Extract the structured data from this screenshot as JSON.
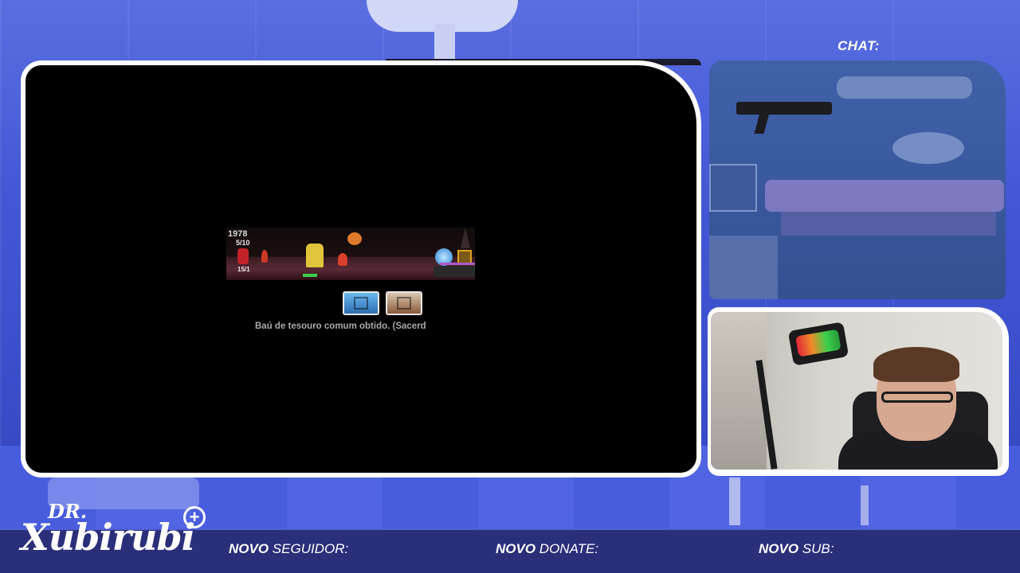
{
  "game": {
    "stat_top": "1978",
    "stat_mid": "5/10",
    "stat_hp": "15/1",
    "message": "Baú de tesouro comum obtido. (Sacerd"
  },
  "chat": {
    "label": "CHAT:"
  },
  "brand": {
    "dr": "DR.",
    "name": "Xubirubi",
    "plus": "+"
  },
  "ticker": {
    "follower_bold": "NOVO",
    "follower_label": "SEGUIDOR:",
    "donate_bold": "NOVO",
    "donate_label": "DONATE:",
    "sub_bold": "NOVO",
    "sub_label": "SUB:"
  }
}
